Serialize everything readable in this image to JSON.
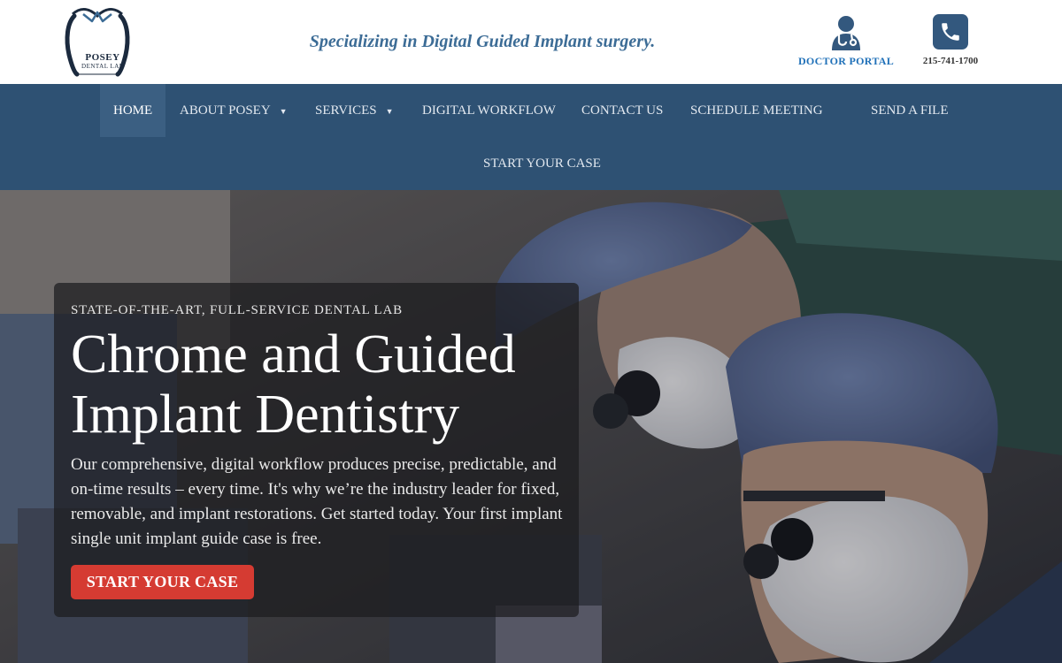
{
  "header": {
    "logo": {
      "name": "POSEY",
      "subtitle": "DENTAL LAB"
    },
    "tagline": "Specializing in Digital Guided Implant surgery.",
    "doctor_portal": {
      "label": "DOCTOR PORTAL",
      "icon": "doctor-icon"
    },
    "phone": {
      "label": "215-741-1700",
      "icon": "phone-icon"
    }
  },
  "nav": {
    "items": [
      {
        "label": "HOME",
        "active": true
      },
      {
        "label": "ABOUT POSEY",
        "dropdown": true
      },
      {
        "label": "SERVICES",
        "dropdown": true
      },
      {
        "label": "DIGITAL WORKFLOW"
      },
      {
        "label": "CONTACT US"
      },
      {
        "label": "SCHEDULE MEETING"
      },
      {
        "label": "SEND A FILE"
      },
      {
        "label": "START YOUR CASE"
      }
    ],
    "dropdown_glyph": "▼"
  },
  "hero": {
    "eyebrow": "STATE-OF-THE-ART, FULL-SERVICE DENTAL LAB",
    "headline": "Chrome and Guided Implant Dentistry",
    "body": "Our comprehensive, digital workflow produces precise, predictable, and on-time results – every time. It's why we’re the industry leader for fixed, removable, and implant restorations. Get started today. Your first implant single unit implant guide case is free.",
    "cta_label": "START YOUR CASE"
  },
  "colors": {
    "nav_bg": "#2e5173",
    "nav_active": "#3b5f82",
    "tagline": "#3c6c96",
    "portal_link": "#1f70b8",
    "cta": "#d53b32"
  }
}
